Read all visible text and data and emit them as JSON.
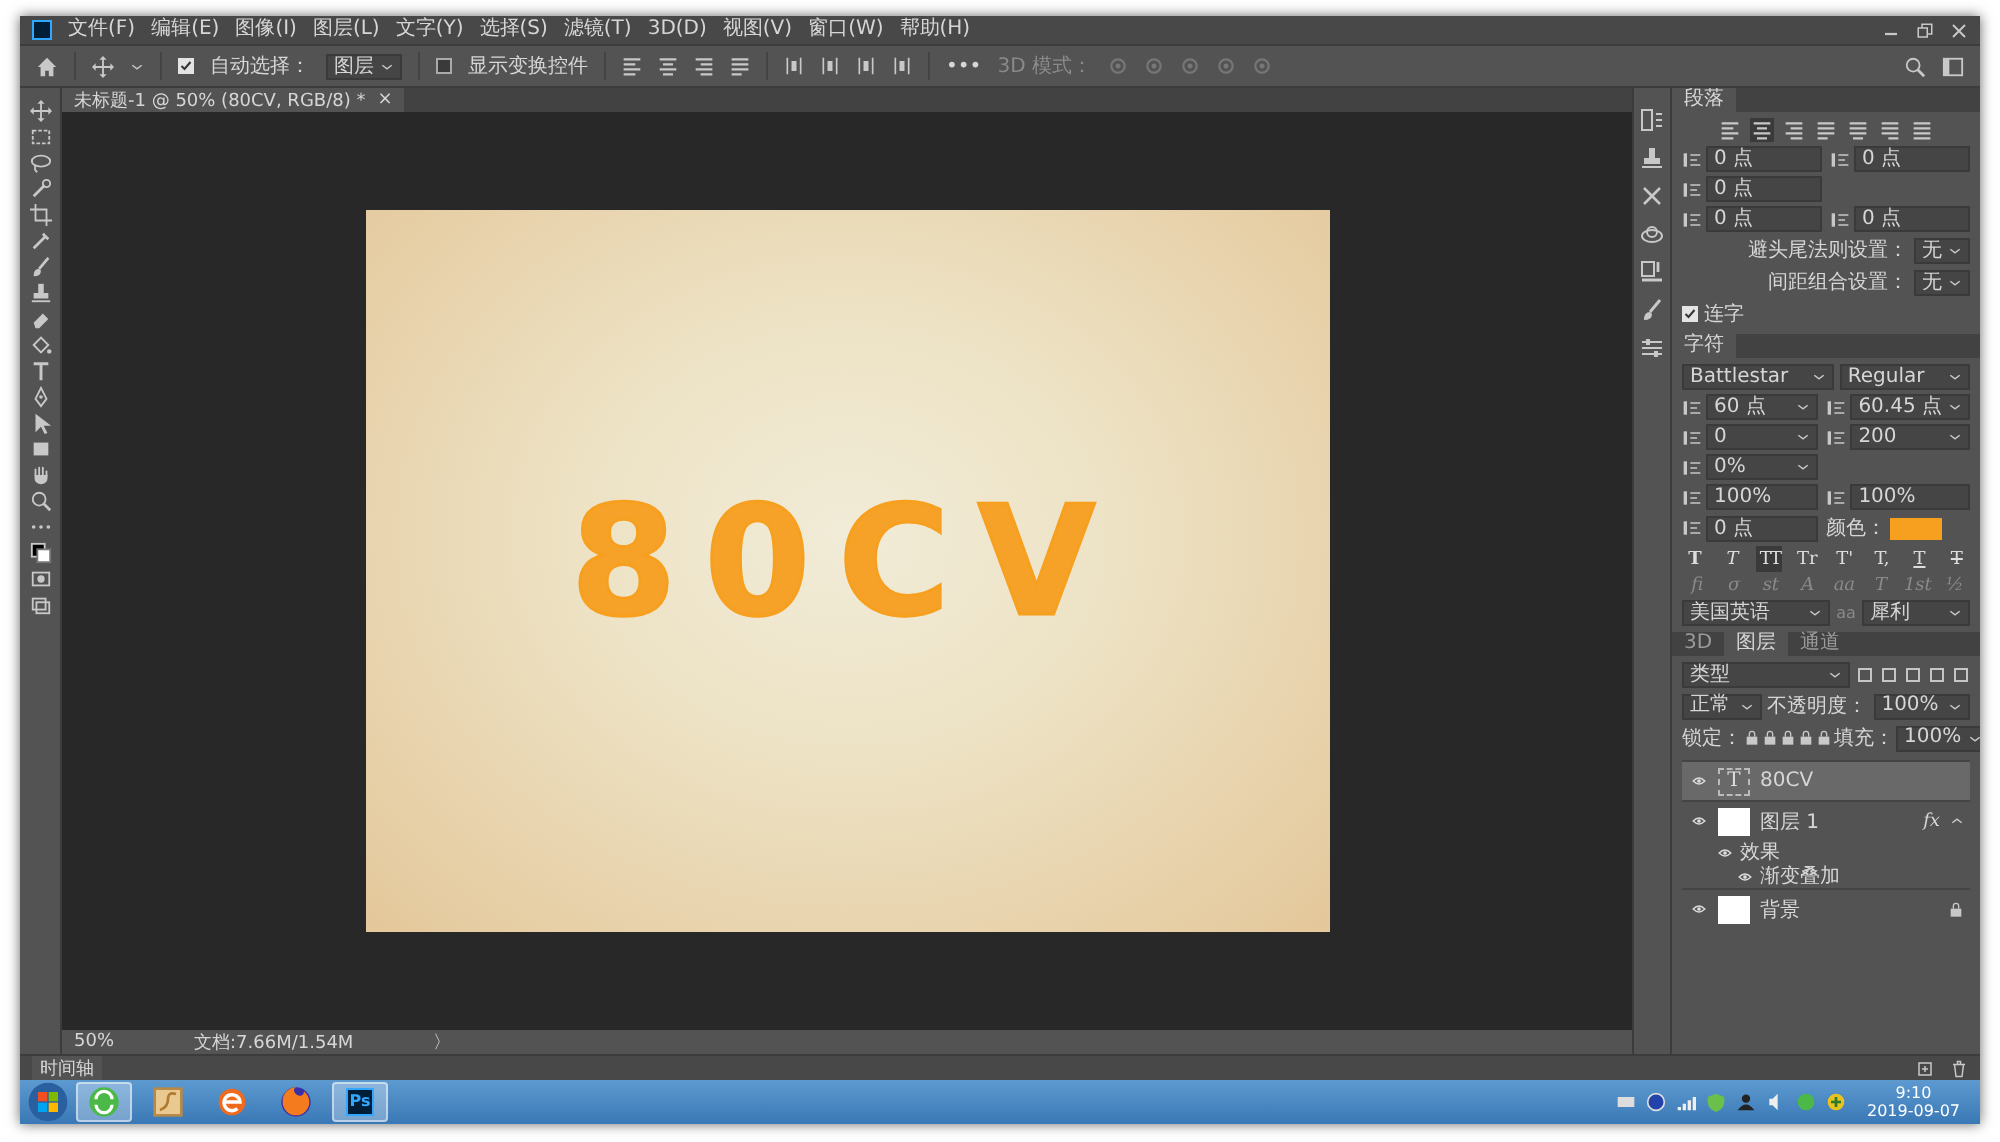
{
  "menu": [
    "文件(F)",
    "编辑(E)",
    "图像(I)",
    "图层(L)",
    "文字(Y)",
    "选择(S)",
    "滤镜(T)",
    "3D(D)",
    "视图(V)",
    "窗口(W)",
    "帮助(H)"
  ],
  "options_bar": {
    "auto_select": {
      "label": "自动选择：",
      "checked": true
    },
    "target": "图层",
    "transform_controls": {
      "label": "显示变换控件",
      "checked": false
    },
    "more": "•••",
    "mode_3d": "3D 模式："
  },
  "document_tab": {
    "title": "未标题-1 @ 50% (80CV, RGB/8) *",
    "close": "×"
  },
  "canvas": {
    "text": "80CV"
  },
  "paragraph_panel": {
    "title": "段落",
    "alignment": [
      {
        "selected": false
      },
      {
        "selected": true
      },
      {
        "selected": false
      },
      {
        "selected": false
      },
      {
        "selected": false
      },
      {
        "selected": false
      },
      {
        "selected": false
      }
    ],
    "indents": [
      [
        {
          "value": "0 点"
        },
        {
          "value": "0 点"
        }
      ],
      [
        {
          "value": "0 点"
        }
      ],
      [
        {
          "value": "0 点"
        },
        {
          "value": "0 点"
        }
      ]
    ],
    "settings": [
      {
        "label": "避头尾法则设置：",
        "value": "无"
      },
      {
        "label": "间距组合设置：",
        "value": "无"
      }
    ],
    "hyphenate": {
      "label": "连字",
      "checked": true
    }
  },
  "character_panel": {
    "title": "字符",
    "font": "Battlestar",
    "style": "Regular",
    "size": "60 点",
    "leading": "60.45 点",
    "kerning": "0",
    "tracking": "200",
    "tsume": "0%",
    "vertical_scale": "100%",
    "horizontal_scale": "100%",
    "baseline_shift": "0 点",
    "color_label": "颜色：",
    "color": "#f7a020",
    "style_buttons": [
      {
        "kind": "bold",
        "label": "T",
        "selected": false
      },
      {
        "kind": "italic",
        "label": "T",
        "selected": false
      },
      {
        "kind": "caps",
        "label": "TT",
        "selected": true
      },
      {
        "kind": "smallcaps",
        "label": "Tr",
        "selected": false
      },
      {
        "kind": "super",
        "label": "T'",
        "selected": false
      },
      {
        "kind": "sub",
        "label": "T,",
        "selected": false
      },
      {
        "kind": "underline",
        "label": "T",
        "selected": false
      },
      {
        "kind": "strike",
        "label": "T",
        "selected": false
      }
    ],
    "opentype_buttons": [
      "fi",
      "σ",
      "st",
      "A",
      "aa",
      "T",
      "1st",
      "½"
    ],
    "language": "美国英语",
    "antialias_icon": "aa",
    "antialias": "犀利"
  },
  "layers_panel": {
    "tabs": [
      {
        "label": "3D",
        "selected": false
      },
      {
        "label": "图层",
        "selected": true
      },
      {
        "label": "通道",
        "selected": false
      }
    ],
    "filter": "类型",
    "blend_mode": "正常",
    "opacity_label": "不透明度：",
    "opacity": "100%",
    "lock_label": "锁定：",
    "fill_label": "填充：",
    "fill": "100%",
    "layers": [
      {
        "name": "80CV",
        "kind": "text",
        "thumbnail": "T",
        "visible": true,
        "selected": true,
        "locked": false
      },
      {
        "name": "图层 1",
        "kind": "fill",
        "visible": true,
        "selected": false,
        "locked": false,
        "fx": "fx",
        "expanded": true,
        "effects_label": "效果",
        "effects": [
          {
            "name": "渐变叠加",
            "visible": true
          }
        ]
      },
      {
        "name": "背景",
        "kind": "fill",
        "visible": true,
        "selected": false,
        "locked": true
      }
    ]
  },
  "status_bar": {
    "zoom": "50%",
    "doc_info": "文档:7.66M/1.54M",
    "arrow": "〉"
  },
  "timeline": {
    "label": "时间轴"
  },
  "taskbar": {
    "apps": [
      {
        "kind": "sync",
        "selected": true
      },
      {
        "kind": "scroll",
        "selected": false
      },
      {
        "kind": "browser",
        "selected": false
      },
      {
        "kind": "fox",
        "selected": false
      },
      {
        "kind": "photoshop",
        "label": "Ps",
        "selected": true
      }
    ],
    "time": "9:10",
    "date": "2019-09-07"
  }
}
